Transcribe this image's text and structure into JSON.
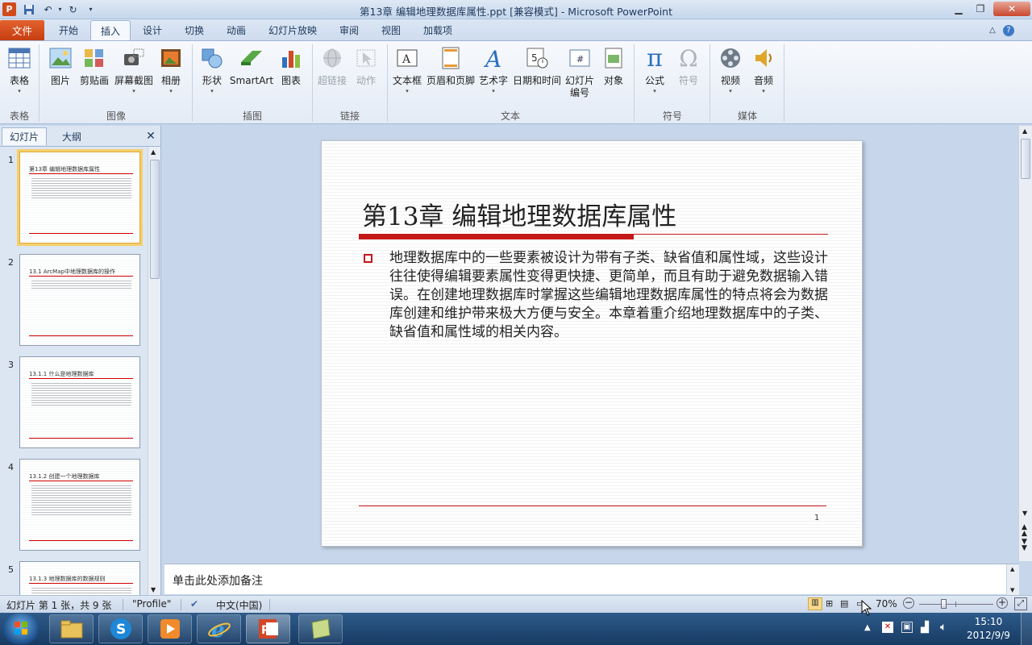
{
  "window": {
    "title": "第13章  编辑地理数据库属性.ppt [兼容模式] - Microsoft PowerPoint"
  },
  "ribbon_tabs": [
    {
      "label": "文件"
    },
    {
      "label": "开始"
    },
    {
      "label": "插入"
    },
    {
      "label": "设计"
    },
    {
      "label": "切换"
    },
    {
      "label": "动画"
    },
    {
      "label": "幻灯片放映"
    },
    {
      "label": "审阅"
    },
    {
      "label": "视图"
    },
    {
      "label": "加载项"
    }
  ],
  "active_tab": "插入",
  "ribbon": {
    "buttons": {
      "table": "表格",
      "picture": "图片",
      "clipart": "剪贴画",
      "screenshot": "屏幕截图",
      "album": "相册",
      "shapes": "形状",
      "smartart": "SmartArt",
      "chart": "图表",
      "hyperlink": "超链接",
      "action": "动作",
      "textbox": "文本框",
      "header_footer": "页眉和页脚",
      "wordart": "艺术字",
      "datetime": "日期和时间",
      "slide_number_1": "幻灯片",
      "slide_number_2": "编号",
      "object": "对象",
      "equation": "公式",
      "symbol": "符号",
      "video": "视频",
      "audio": "音频"
    },
    "groups": {
      "tables": "表格",
      "images": "图像",
      "illustrations": "插图",
      "links": "链接",
      "text": "文本",
      "symbols": "符号",
      "media": "媒体"
    },
    "colors": {
      "file_tab": "#d8501f",
      "accent_red": "#c41818"
    }
  },
  "pane": {
    "tab_slides": "幻灯片",
    "tab_outline": "大纲",
    "thumbnails": [
      {
        "num": "1",
        "title": "第13章   编辑地理数据库属性"
      },
      {
        "num": "2",
        "title": "13.1   ArcMap中地理数据库的操作"
      },
      {
        "num": "3",
        "title": "13.1.1   什么是地理数据库"
      },
      {
        "num": "4",
        "title": "13.1.2  创建一个地理数据库"
      },
      {
        "num": "5",
        "title": "13.1.3   地理数据库的数据规则"
      }
    ]
  },
  "slide": {
    "title": "第13章    编辑地理数据库属性",
    "body": "地理数据库中的一些要素被设计为带有子类、缺省值和属性域，这些设计往往使得编辑要素属性变得更快捷、更简单，而且有助于避免数据输入错误。在创建地理数据库时掌握这些编辑地理数据库属性的特点将会为数据库创建和维护带来极大方便与安全。本章着重介绍地理数据库中的子类、缺省值和属性域的相关内容。",
    "page_number": "1"
  },
  "notes": {
    "placeholder": "单击此处添加备注"
  },
  "status_bar": {
    "slide_info": "幻灯片 第 1 张，共 9 张",
    "theme": "\"Profile\"",
    "language": "中文(中国)",
    "zoom": "70%",
    "zoom_level_percent": 70
  },
  "taskbar": {
    "time": "15:10",
    "date": "2012/9/9",
    "apps": [
      "windows-explorer",
      "sogou",
      "media-player",
      "internet-explorer",
      "powerpoint",
      "notepad"
    ]
  }
}
